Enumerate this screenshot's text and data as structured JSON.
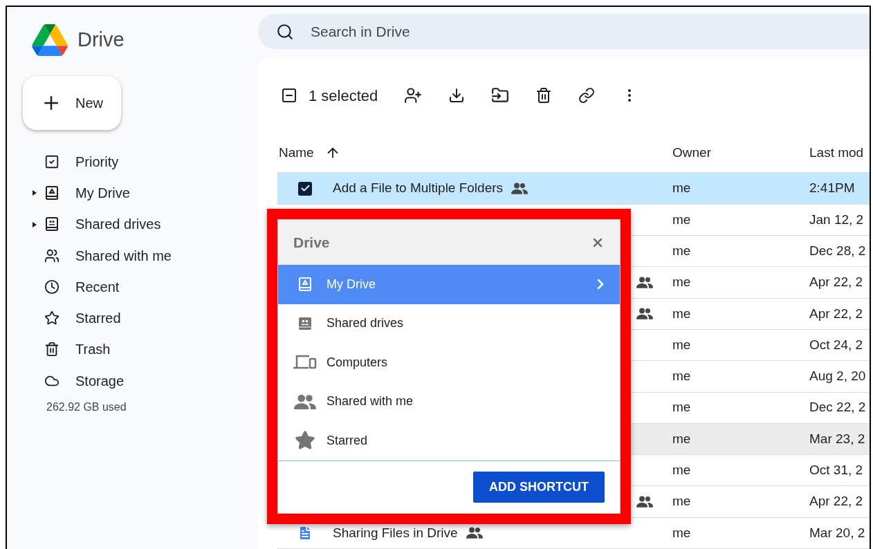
{
  "app": {
    "title": "Drive"
  },
  "new_button": {
    "label": "New"
  },
  "sidebar": {
    "items": [
      {
        "label": "Priority",
        "kind": "priority",
        "expandable": false
      },
      {
        "label": "My Drive",
        "kind": "my-drive",
        "expandable": true
      },
      {
        "label": "Shared drives",
        "kind": "shared-drives",
        "expandable": true
      },
      {
        "label": "Shared with me",
        "kind": "shared",
        "expandable": false
      },
      {
        "label": "Recent",
        "kind": "recent",
        "expandable": false
      },
      {
        "label": "Starred",
        "kind": "starred",
        "expandable": false
      },
      {
        "label": "Trash",
        "kind": "trash",
        "expandable": false
      },
      {
        "label": "Storage",
        "kind": "storage",
        "expandable": false
      }
    ],
    "storage_used": "262.92 GB used"
  },
  "search": {
    "placeholder": "Search in Drive"
  },
  "toolbar": {
    "selection": "1 selected"
  },
  "table": {
    "columns": [
      "Name",
      "Owner",
      "Last mod"
    ],
    "rows": [
      {
        "name": "Add a File to Multiple Folders",
        "shared": true,
        "owner": "me",
        "modified": "2:41PM",
        "selected": true,
        "hovered": false
      },
      {
        "shared": false,
        "owner": "me",
        "modified": "Jan 12, 2",
        "selected": false,
        "hovered": false
      },
      {
        "shared": false,
        "owner": "me",
        "modified": "Dec 28, 2",
        "selected": false,
        "hovered": false
      },
      {
        "shared": true,
        "owner": "me",
        "modified": "Apr 22, 2",
        "selected": false,
        "hovered": false
      },
      {
        "shared": true,
        "owner": "me",
        "modified": "Apr 22, 2",
        "selected": false,
        "hovered": false
      },
      {
        "shared": false,
        "owner": "me",
        "modified": "Oct 24, 2",
        "selected": false,
        "hovered": false
      },
      {
        "shared": false,
        "owner": "me",
        "modified": "Aug 2, 20",
        "selected": false,
        "hovered": false
      },
      {
        "shared": false,
        "owner": "me",
        "modified": "Dec 22, 2",
        "selected": false,
        "hovered": false
      },
      {
        "shared": false,
        "owner": "me",
        "modified": "Mar 23, 2",
        "selected": false,
        "hovered": true
      },
      {
        "shared": false,
        "owner": "me",
        "modified": "Oct 31, 2",
        "selected": false,
        "hovered": false
      },
      {
        "shared": true,
        "owner": "me",
        "modified": "Apr 22, 2",
        "selected": false,
        "hovered": false
      },
      {
        "name": "Sharing Files in Drive",
        "kind": "doc",
        "shared": true,
        "owner": "me",
        "modified": "Mar 20, 2",
        "selected": false,
        "hovered": false
      }
    ]
  },
  "dialog": {
    "title": "Drive",
    "highlighted": true,
    "items": [
      {
        "label": "My Drive",
        "kind": "my-drive",
        "selected": true
      },
      {
        "label": "Shared drives",
        "kind": "shared-drives",
        "selected": false
      },
      {
        "label": "Computers",
        "kind": "computers",
        "selected": false
      },
      {
        "label": "Shared with me",
        "kind": "shared",
        "selected": false
      },
      {
        "label": "Starred",
        "kind": "starred",
        "selected": false
      }
    ],
    "button": "ADD SHORTCUT"
  }
}
